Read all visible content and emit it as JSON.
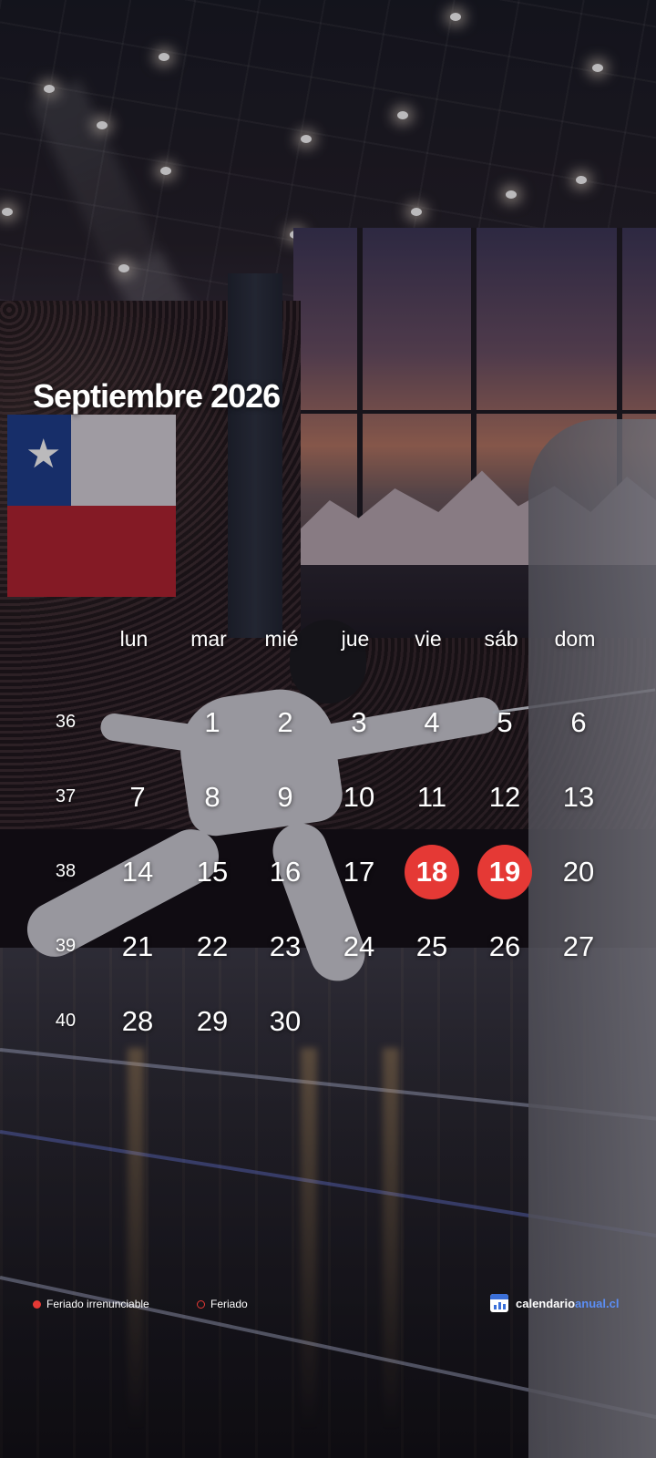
{
  "calendar": {
    "title": "Septiembre 2026",
    "weekdays": [
      "lun",
      "mar",
      "mié",
      "jue",
      "vie",
      "sáb",
      "dom"
    ],
    "weeks": [
      {
        "week": "36",
        "days": [
          "",
          "1",
          "2",
          "3",
          "4",
          "5",
          "6"
        ]
      },
      {
        "week": "37",
        "days": [
          "7",
          "8",
          "9",
          "10",
          "11",
          "12",
          "13"
        ]
      },
      {
        "week": "38",
        "days": [
          "14",
          "15",
          "16",
          "17",
          "18",
          "19",
          "20"
        ]
      },
      {
        "week": "39",
        "days": [
          "21",
          "22",
          "23",
          "24",
          "25",
          "26",
          "27"
        ]
      },
      {
        "week": "40",
        "days": [
          "28",
          "29",
          "30",
          "",
          "",
          "",
          ""
        ]
      }
    ],
    "holidays": [
      "18",
      "19"
    ]
  },
  "legend": {
    "irrenunciable_label": "Feriado irrenunciable",
    "feriado_label": "Feriado"
  },
  "brand": {
    "name_part1": "calendario",
    "name_part2": "anual.cl"
  },
  "colors": {
    "holiday": "#e53935",
    "brand_accent": "#5b8ef5",
    "text": "#ffffff"
  }
}
